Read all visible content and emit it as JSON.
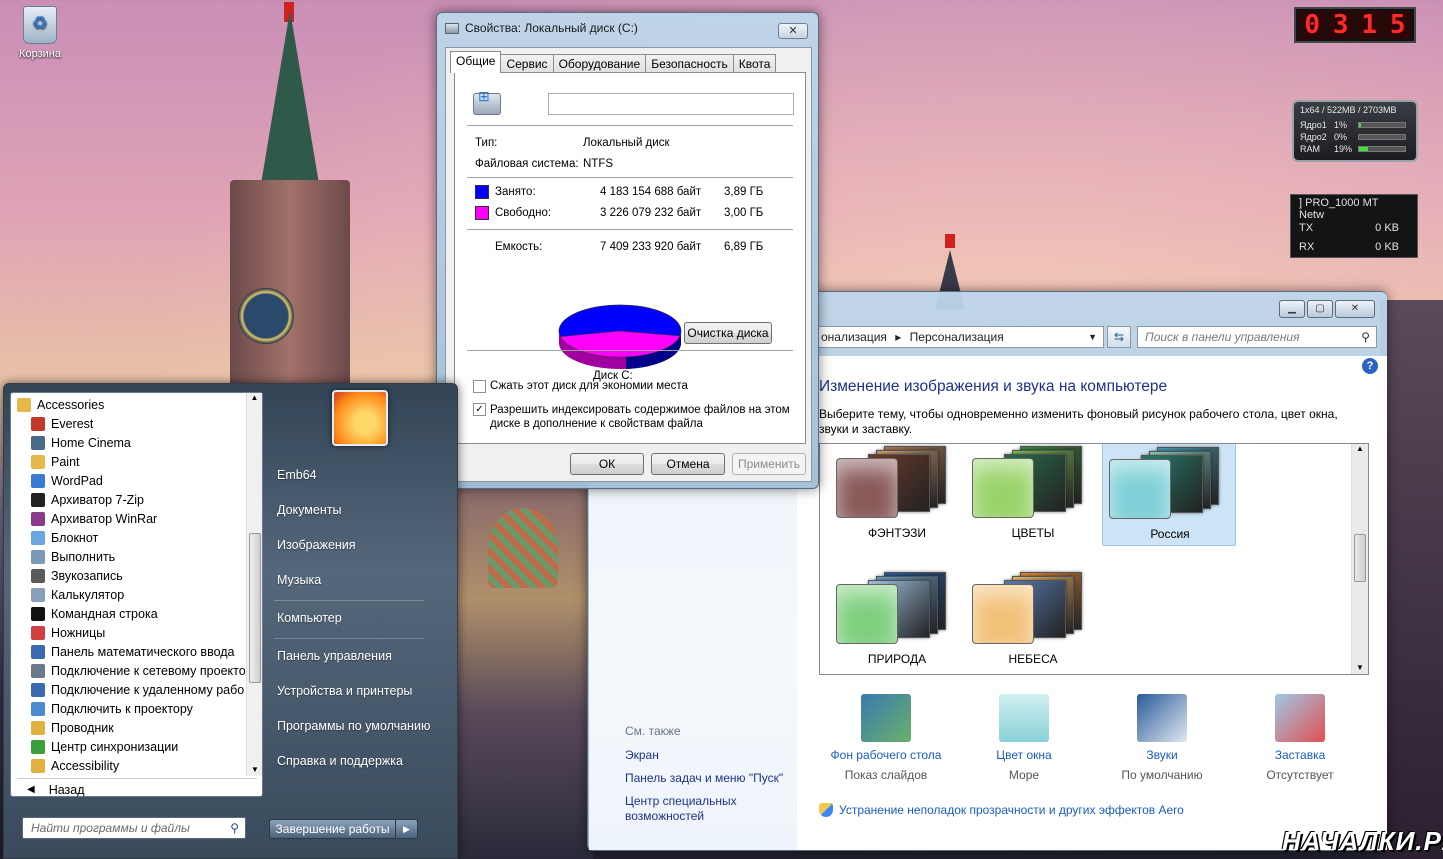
{
  "desktop": {
    "recycle_bin_label": "Корзина",
    "watermark": "НАЧАЛКИ.РУ"
  },
  "gadgets": {
    "clock_digits": [
      "0",
      "3",
      "1",
      "5"
    ],
    "cpu": {
      "header": "1x64 / 522MB / 2703MB",
      "rows": [
        {
          "label": "Ядро1",
          "value": "1%",
          "fraction": 0.01
        },
        {
          "label": "Ядро2",
          "value": "0%",
          "fraction": 0.0
        },
        {
          "label": "RAM",
          "value": "19%",
          "fraction": 0.19
        }
      ]
    },
    "network": {
      "adapter": "] PRO_1000 MT Netw",
      "tx_label": "TX",
      "tx_value": "0 KB",
      "rx_label": "RX",
      "rx_value": "0 KB"
    }
  },
  "properties": {
    "title": "Свойства: Локальный диск (C:)",
    "close": "✕",
    "tabs": [
      "Общие",
      "Сервис",
      "Оборудование",
      "Безопасность",
      "Квота"
    ],
    "active_tab": "Общие",
    "name_value": "",
    "type_label": "Тип:",
    "type_value": "Локальный диск",
    "fs_label": "Файловая система:",
    "fs_value": "NTFS",
    "used_label": "Занято:",
    "used_bytes": "4 183 154 688 байт",
    "used_gb": "3,89 ГБ",
    "used_color": "#0000ff",
    "free_label": "Свободно:",
    "free_bytes": "3 226 079 232 байт",
    "free_gb": "3,00 ГБ",
    "free_color": "#ff00ff",
    "capacity_label": "Емкость:",
    "capacity_bytes": "7 409 233 920 байт",
    "capacity_gb": "6,89 ГБ",
    "used_fraction": 0.5646,
    "disk_label": "Диск C:",
    "cleanup_button": "Очистка диска",
    "compress_label": "Сжать этот диск для экономии места",
    "compress_checked": false,
    "index_label": "Разрешить индексировать содержимое файлов на этом диске в дополнение к свойствам файла",
    "index_checked": true,
    "ok": "ОК",
    "cancel": "Отмена",
    "apply": "Применить"
  },
  "control_panel": {
    "breadcrumb_1": "онализация",
    "breadcrumb_sep": "▸",
    "breadcrumb_2": "Персонализация",
    "search_placeholder": "Поиск в панели управления",
    "heading": "Изменение изображения и звука на компьютере",
    "description": "Выберите тему, чтобы одновременно изменить фоновый рисунок рабочего стола, цвет окна, звуки и заставку.",
    "themes": [
      {
        "name": "ФЭНТЭЗИ",
        "selected": false,
        "color": "#8a5a5a"
      },
      {
        "name": "ЦВЕТЫ",
        "selected": false,
        "color": "#9ad36a"
      },
      {
        "name": "Россия",
        "selected": true,
        "color": "#7fd0d8"
      },
      {
        "name": "ПРИРОДА",
        "selected": false,
        "color": "#7fcf7f"
      },
      {
        "name": "НЕБЕСА",
        "selected": false,
        "color": "#f2c27a"
      }
    ],
    "bottom_items": [
      {
        "link": "Фон рабочего стола",
        "sub": "Показ слайдов",
        "icon": "desktop-background-icon"
      },
      {
        "link": "Цвет окна",
        "sub": "Море",
        "icon": "window-color-icon"
      },
      {
        "link": "Звуки",
        "sub": "По умолчанию",
        "icon": "sounds-icon"
      },
      {
        "link": "Заставка",
        "sub": "Отсутствует",
        "icon": "screensaver-icon"
      }
    ],
    "see_also_header": "См. также",
    "see_also": [
      "Экран",
      "Панель задач и меню \"Пуск\"",
      "Центр специальных возможностей"
    ],
    "aero_link": "Устранение неполадок прозрачности и других эффектов Aero"
  },
  "start_menu": {
    "folder": "Accessories",
    "programs": [
      {
        "label": "Everest",
        "color": "#c0392b"
      },
      {
        "label": "Home Cinema",
        "color": "#4a6a8a"
      },
      {
        "label": "Paint",
        "color": "#e6b84a"
      },
      {
        "label": "WordPad",
        "color": "#3a7ad0"
      },
      {
        "label": "Архиватор 7-Zip",
        "color": "#222222"
      },
      {
        "label": "Архиватор WinRar",
        "color": "#8a3a8a"
      },
      {
        "label": "Блокнот",
        "color": "#6aa6e0"
      },
      {
        "label": "Выполнить",
        "color": "#7a9ab8"
      },
      {
        "label": "Звукозапись",
        "color": "#5a5a5a"
      },
      {
        "label": "Калькулятор",
        "color": "#8aa0b8"
      },
      {
        "label": "Командная строка",
        "color": "#111111"
      },
      {
        "label": "Ножницы",
        "color": "#d04040"
      },
      {
        "label": "Панель математического ввода",
        "color": "#3a6ab0"
      },
      {
        "label": "Подключение к сетевому проекто",
        "color": "#6a7a8a"
      },
      {
        "label": "Подключение к удаленному рабо",
        "color": "#3a6ab0"
      },
      {
        "label": "Подключить к проектору",
        "color": "#4a8ad0"
      },
      {
        "label": "Проводник",
        "color": "#e0b040"
      },
      {
        "label": "Центр синхронизации",
        "color": "#3aa03a"
      },
      {
        "label": "Accessibility",
        "color": "#e0b040"
      }
    ],
    "back": "Назад",
    "search_placeholder": "Найти программы и файлы",
    "right_items": [
      "Emb64",
      "Документы",
      "Изображения",
      "Музыка",
      "Компьютер",
      "Панель управления",
      "Устройства и принтеры",
      "Программы по умолчанию",
      "Справка и поддержка"
    ],
    "shutdown": "Завершение работы"
  }
}
